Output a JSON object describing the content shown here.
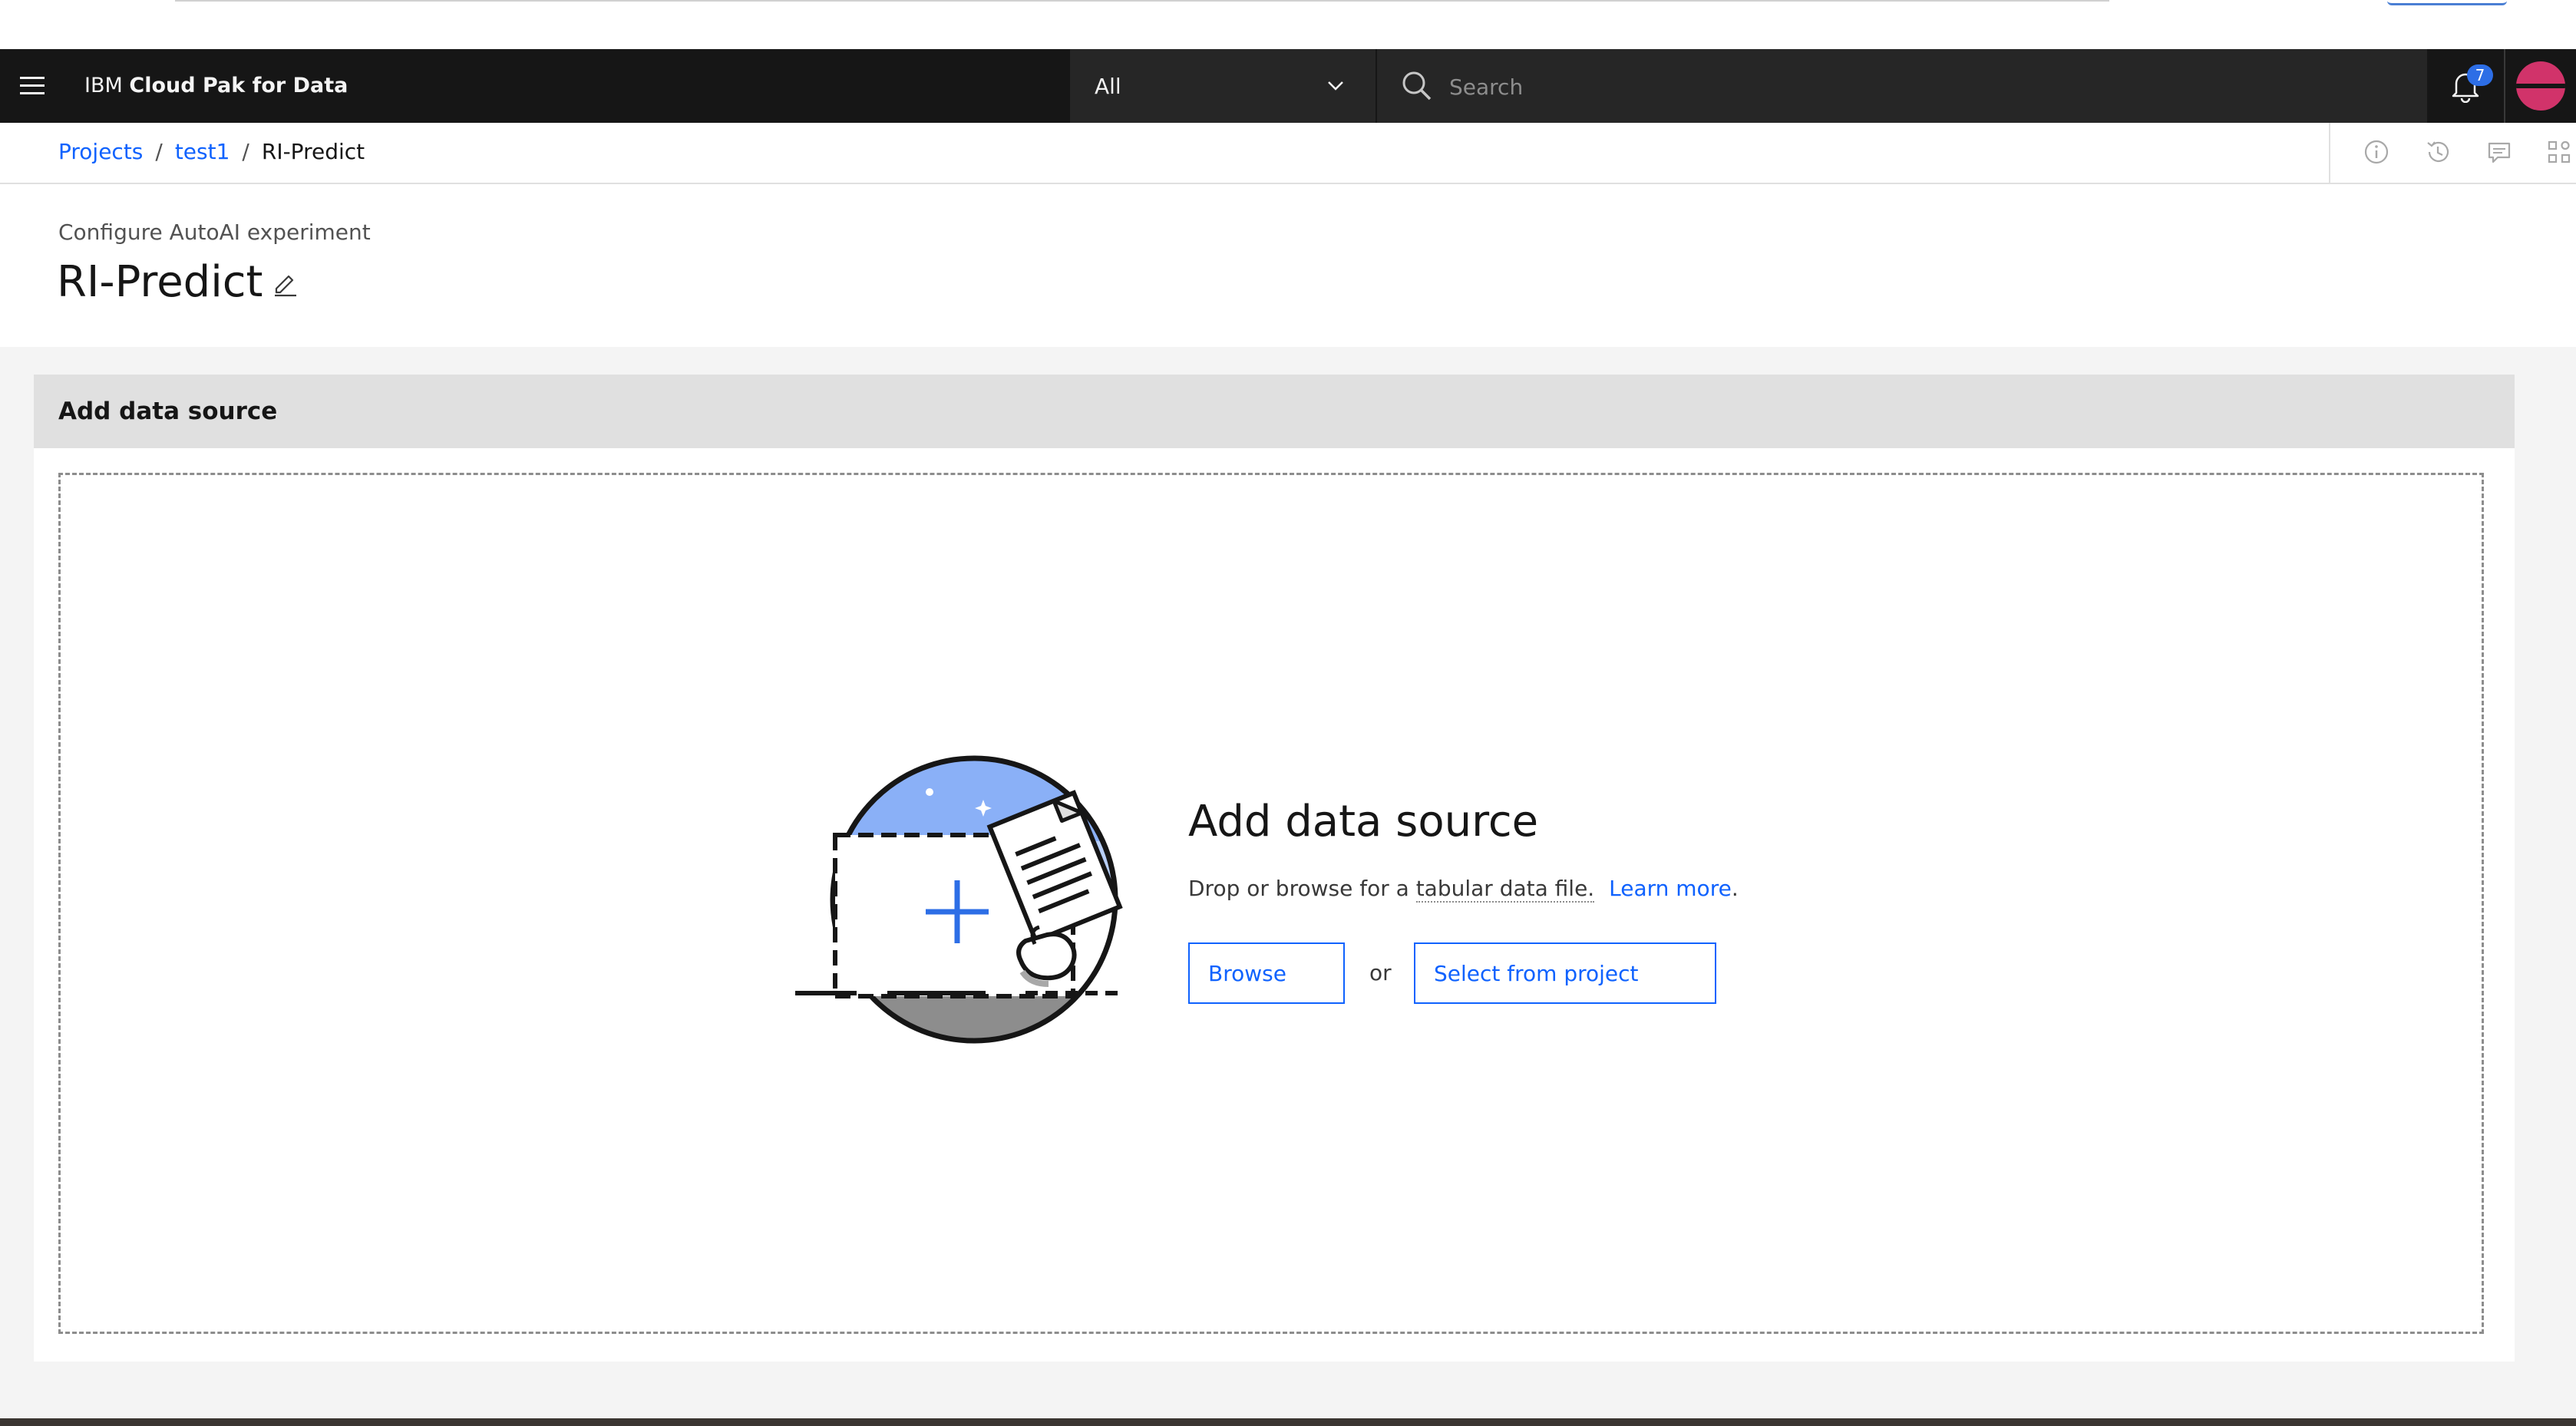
{
  "header": {
    "brand_prefix": "IBM",
    "brand_name": "Cloud Pak for Data",
    "scope_select_value": "All",
    "search_placeholder": "Search",
    "notification_count": "7"
  },
  "breadcrumb": {
    "items": [
      "Projects",
      "test1"
    ],
    "current": "RI-Predict",
    "separator": "/"
  },
  "page": {
    "subtitle": "Configure AutoAI experiment",
    "title": "RI-Predict"
  },
  "card": {
    "header_title": "Add data source",
    "dropzone": {
      "title": "Add data source",
      "description_prefix": "Drop or browse for a",
      "description_term": "tabular data file.",
      "learn_more": "Learn more",
      "learn_more_suffix": ".",
      "browse_label": "Browse",
      "or_label": "or",
      "select_label": "Select from project"
    }
  },
  "colors": {
    "header_bg": "#161616",
    "link": "#0f62fe",
    "notification_badge": "#2d6ee6",
    "avatar": "#d1336a"
  },
  "icons": [
    "hamburger-menu-icon",
    "chevron-down-icon",
    "search-icon",
    "notification-bell-icon",
    "avatar",
    "information-icon",
    "history-icon",
    "comment-icon",
    "apps-icon",
    "edit-pencil-icon",
    "upload-illustration"
  ]
}
